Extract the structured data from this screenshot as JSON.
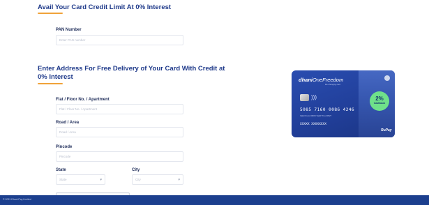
{
  "sections": {
    "credit_title": "Avail Your Card Credit Limit At 0% Interest",
    "address_title": "Enter Address For Free Delivery of Your Card With Credit at 0% Interest"
  },
  "fields": {
    "pan": {
      "label": "PAN Number",
      "placeholder": "Enter PAN number"
    },
    "flat": {
      "label": "Flat / Floor No. / Apartment",
      "placeholder": "Flat / Floor No. / Apartment"
    },
    "road": {
      "label": "Road / Area",
      "placeholder": "Road / Area"
    },
    "pincode": {
      "label": "Pincode",
      "placeholder": "Pincode"
    },
    "state": {
      "label": "State",
      "value": "State"
    },
    "city": {
      "label": "City",
      "value": "City"
    }
  },
  "card": {
    "brand_bold": "dhani",
    "brand_light": "OneFreedom",
    "subtitle": "life-changing card",
    "number": "5085 7160 0086 4246",
    "dates": "Valid From 08/20    Valid Thru 08/27",
    "holder": "XXXXX XXXXXXXX",
    "cashback_pct": "2%",
    "cashback_text": "Cashback",
    "network": "RuPay"
  },
  "footer": {
    "text": "© 2021 Dhani Pay Limited"
  },
  "colors": {
    "primary": "#1f3a8a",
    "accent": "#f0a33a",
    "footer": "#1c3f8e",
    "cashback": "#6fe18a"
  }
}
